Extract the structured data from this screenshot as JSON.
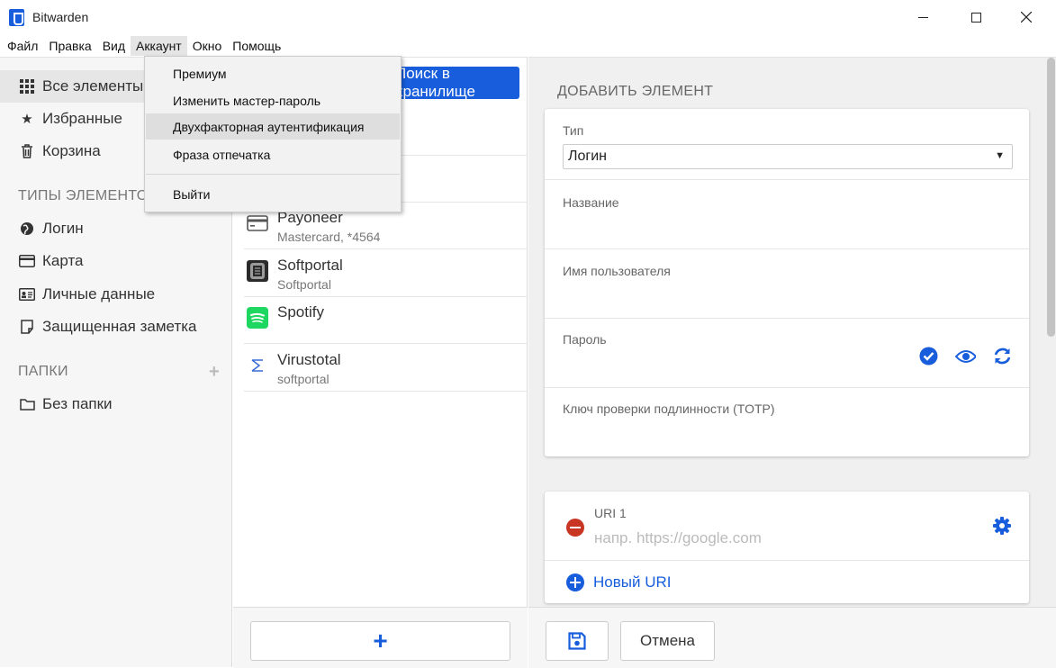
{
  "window": {
    "title": "Bitwarden"
  },
  "menubar": [
    "Файл",
    "Правка",
    "Вид",
    "Аккаунт",
    "Окно",
    "Помощь"
  ],
  "account_menu": {
    "items": [
      "Премиум",
      "Изменить мастер-пароль",
      "Двухфакторная аутентификация",
      "Фраза отпечатка"
    ],
    "logout": "Выйти"
  },
  "sidebar": {
    "all_items": "Все элементы",
    "favorites": "Избранные",
    "trash": "Корзина",
    "types_heading": "ТИПЫ ЭЛЕМЕНТОВ",
    "types": [
      "Логин",
      "Карта",
      "Личные данные",
      "Защищенная заметка"
    ],
    "folders_heading": "ПАПКИ",
    "no_folder": "Без папки"
  },
  "list": {
    "search_label": "Поиск в хранилище",
    "items": [
      {
        "name": "Payoneer",
        "sub": "Mastercard, *4564",
        "icon": "card-icon"
      },
      {
        "name": "Softportal",
        "sub": "Softportal",
        "icon": "softportal-icon"
      },
      {
        "name": "Spotify",
        "sub": "",
        "icon": "spotify-icon"
      },
      {
        "name": "Virustotal",
        "sub": "softportal",
        "icon": "virustotal-icon"
      }
    ]
  },
  "details": {
    "heading": "ДОБАВИТЬ ЭЛЕМЕНТ",
    "type_label": "Тип",
    "type_value": "Логин",
    "name_label": "Название",
    "username_label": "Имя пользователя",
    "password_label": "Пароль",
    "totp_label": "Ключ проверки подлинности (TOTP)",
    "uri_label": "URI 1",
    "uri_placeholder": "напр. https://google.com",
    "new_uri": "Новый URI",
    "cancel": "Отмена"
  },
  "colors": {
    "accent": "#175ddc",
    "danger": "#c83522"
  }
}
